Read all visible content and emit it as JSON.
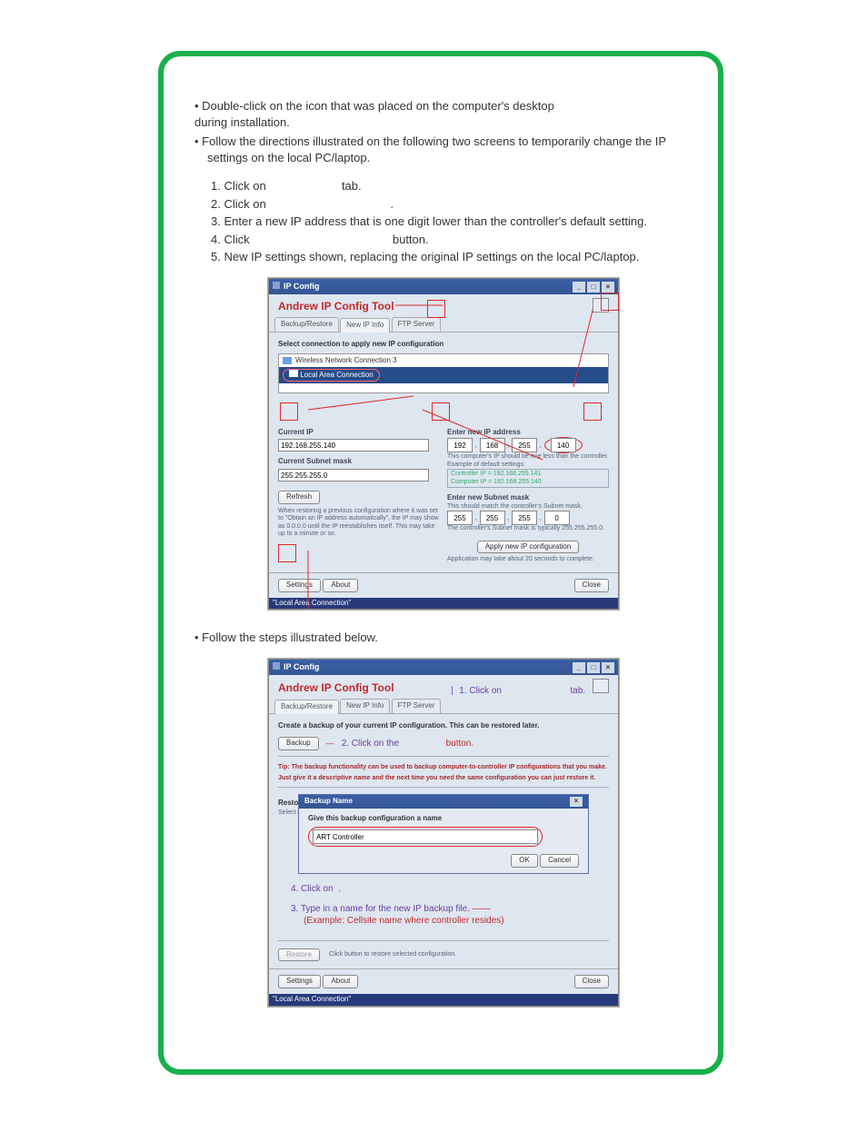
{
  "intro": {
    "bullet1_a": "Double-click on the ",
    "bullet1_b": " icon that was placed on the computer's desktop",
    "bullet1_c": "during   installation.",
    "bullet2": "Follow the directions illustrated on the following two screens to temporarily change the IP settings on the local PC/laptop."
  },
  "steps": {
    "s1_a": "1. Click on ",
    "s1_b": " tab.",
    "s2_a": "2. Click on ",
    "s2_b": ".",
    "s3": "3. Enter a new IP address that is one digit lower than the controller's default setting.",
    "s4_a": "4. Click ",
    "s4_b": " button.",
    "s5": "5. New IP settings shown, replacing the original IP settings on the local PC/laptop."
  },
  "win1": {
    "title": "IP Config",
    "app_title": "Andrew IP Config Tool",
    "tabs": {
      "t1": "Backup/Restore",
      "t2": "New IP Info",
      "t3": "FTP Server"
    },
    "sel_label": "Select connection to apply new IP configuration",
    "net1": "Wireless Network Connection 3",
    "net2": "Local Area Connection",
    "cur_ip_label": "Current IP",
    "cur_ip": "192.168.255.140",
    "cur_mask_label": "Current Subnet mask",
    "cur_mask": "255.255.255.0",
    "refresh": "Refresh",
    "restore_hint": "When restoring a previous configuration where it was set to \"Obtain an IP address automatically\", the IP may show as 0.0.0.0 until the IP reestablishes itself.  This may take up to a minute or so.",
    "new_ip_label": "Enter new IP address",
    "ip": {
      "a": "192",
      "b": "168",
      "c": "255",
      "d": "140"
    },
    "ip_hint": "This computer's IP should be one less than the controller.",
    "example_label": "Example of default settings:",
    "ex1": "Controller IP = 192.168.255.141",
    "ex2": "Computer IP = 192.168.255.140",
    "new_mask_label": "Enter new Subnet mask",
    "mask_hint1": "This should match the controller's Subnet mask.",
    "mask": {
      "a": "255",
      "b": "255",
      "c": "255",
      "d": "0"
    },
    "mask_hint2": "The controller's Subnet mask is typically 255.255.255.0.",
    "apply": "Apply new IP configuration",
    "apply_hint": "Application may take about 20 seconds to complete.",
    "settings": "Settings",
    "about": "About",
    "close": "Close",
    "status": "\"Local Area Connection\""
  },
  "mid_bullet": "Follow the steps illustrated below.",
  "win2": {
    "title": "IP Config",
    "app_title": "Andrew IP Config Tool",
    "call1_a": "1. Click  on ",
    "call1_b": " tab.",
    "tabs": {
      "t1": "Backup/Restore",
      "t2": "New IP Info",
      "t3": "FTP Server"
    },
    "create_backup_label": "Create a backup of your current IP configuration. This can be restored later.",
    "backup_btn": "Backup",
    "call2_a": "2.  Click on the ",
    "call2_b": " button.",
    "tip": "Tip: The backup functionality can be used to backup computer-to-controller IP configurations that you make.  Just give it a descriptive name and the next time you need the same configuration you can just restore it.",
    "restore_from_label": "Restore from backup",
    "select_backup_label": "Select backup configu",
    "dlg_title": "Backup Name",
    "dlg_prompt": "Give this backup configuration a name",
    "dlg_value": "ART Controller",
    "ok": "OK",
    "cancel": "Cancel",
    "call4": "4. Click on ",
    "call3": "3.  Type in a name for the new IP backup file.",
    "call3b": "(Example: Cellsite name where controller resides)",
    "restore_btn": "Restore",
    "restore_hint": "Click button to restore selected configuration.",
    "settings": "Settings",
    "about": "About",
    "close": "Close",
    "status": "\"Local Area Connection\""
  }
}
